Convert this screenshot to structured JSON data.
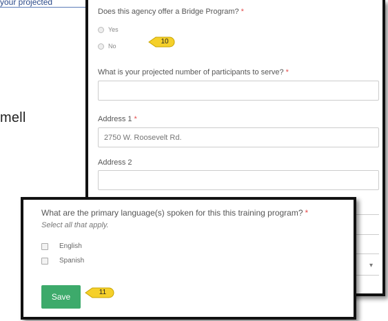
{
  "background": {
    "top_text": "your projected",
    "side_text": "mell"
  },
  "form_back": {
    "bridge_question": "Does this agency offer a Bridge Program?",
    "required_mark": "*",
    "options": [
      "Yes",
      "No"
    ],
    "participants_question": "What is your projected number of participants to serve?",
    "participants_value": "",
    "address1_label": "Address 1",
    "address1_placeholder": "2750 W. Roosevelt Rd.",
    "address2_label": "Address 2",
    "address2_value": "",
    "select_icon": "chevron-down-icon"
  },
  "form_front": {
    "language_question": "What are the primary language(s) spoken for this this training program?",
    "hint": "Select all that apply.",
    "options": [
      "English",
      "Spanish"
    ],
    "save_label": "Save"
  },
  "callouts": {
    "step_a": "10",
    "step_b": "11",
    "color": "#f5d02a"
  }
}
